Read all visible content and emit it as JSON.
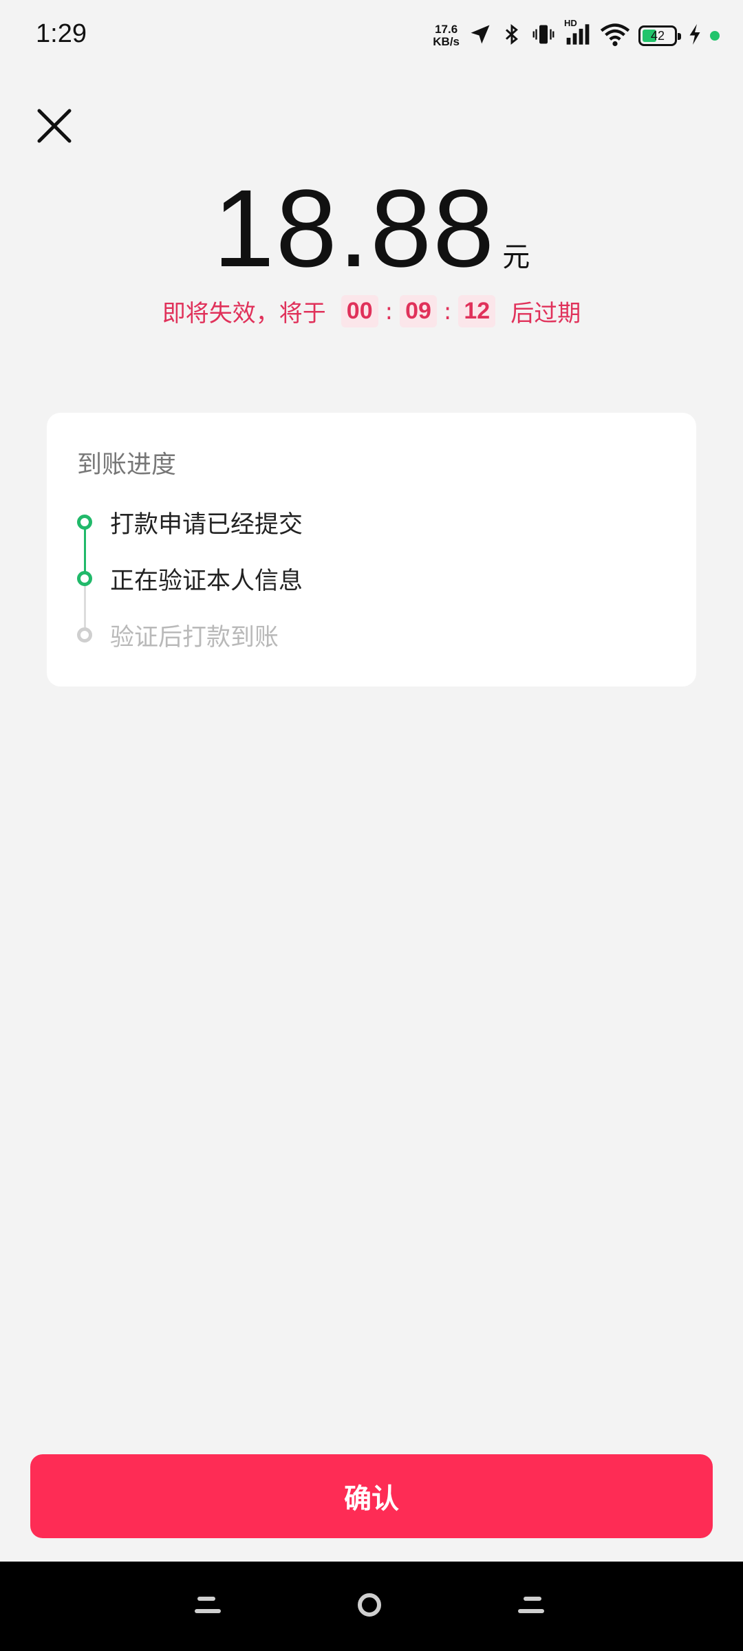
{
  "status_bar": {
    "time": "1:29",
    "net_speed_value": "17.6",
    "net_speed_unit": "KB/s",
    "hd_label": "HD",
    "battery_level": "42",
    "icons": [
      "location-arrow-icon",
      "bluetooth-icon",
      "vibrate-icon",
      "signal-icon",
      "wifi-icon",
      "battery-icon",
      "charging-icon",
      "green-dot-indicator"
    ]
  },
  "header": {
    "close_icon": "close-icon"
  },
  "amount": {
    "value": "18.88",
    "unit": "元"
  },
  "expire": {
    "prefix": "即将失效，将于",
    "hours": "00",
    "minutes": "09",
    "seconds": "12",
    "separator": ":",
    "suffix": "后过期"
  },
  "progress": {
    "title": "到账进度",
    "steps": [
      {
        "label": "打款申请已经提交",
        "status": "done"
      },
      {
        "label": "正在验证本人信息",
        "status": "done"
      },
      {
        "label": "验证后打款到账",
        "status": "pending"
      }
    ]
  },
  "confirm": {
    "label": "确认"
  },
  "colors": {
    "accent": "#fe2c55",
    "warning_text": "#e0315a",
    "success": "#21b96a",
    "pending": "#cfcfcf",
    "background": "#f3f3f3"
  },
  "nav_bar": {
    "icons": [
      "back-nav-icon",
      "home-nav-icon",
      "recents-nav-icon"
    ]
  }
}
